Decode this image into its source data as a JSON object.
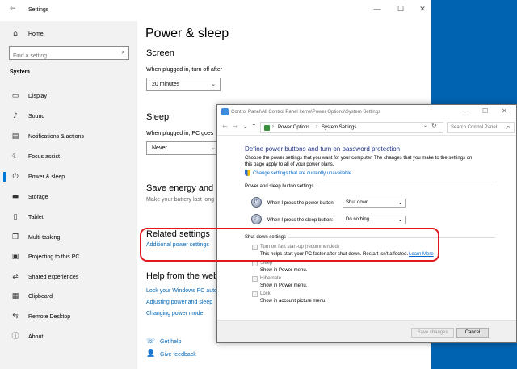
{
  "settings": {
    "title": "Settings",
    "home_label": "Home",
    "search_placeholder": "Find a setting",
    "section_label": "System",
    "sidebar_items": [
      {
        "label": "Display",
        "icon": "display-icon"
      },
      {
        "label": "Sound",
        "icon": "sound-icon"
      },
      {
        "label": "Notifications & actions",
        "icon": "notifications-icon"
      },
      {
        "label": "Focus assist",
        "icon": "moon-icon"
      },
      {
        "label": "Power & sleep",
        "icon": "power-icon"
      },
      {
        "label": "Storage",
        "icon": "storage-icon"
      },
      {
        "label": "Tablet",
        "icon": "tablet-icon"
      },
      {
        "label": "Multi-tasking",
        "icon": "multitasking-icon"
      },
      {
        "label": "Projecting to this PC",
        "icon": "projecting-icon"
      },
      {
        "label": "Shared experiences",
        "icon": "shared-icon"
      },
      {
        "label": "Clipboard",
        "icon": "clipboard-icon"
      },
      {
        "label": "Remote Desktop",
        "icon": "remote-icon"
      },
      {
        "label": "About",
        "icon": "info-icon"
      }
    ],
    "page_title": "Power & sleep",
    "screen_heading": "Screen",
    "screen_label": "When plugged in, turn off after",
    "screen_value": "20 minutes",
    "sleep_heading": "Sleep",
    "sleep_label": "When plugged in, PC goes",
    "sleep_value": "Never",
    "save_heading": "Save energy and ba",
    "save_text": "Make your battery last long",
    "related_heading": "Related settings",
    "related_link": "Additional power settings",
    "help_heading": "Help from the web",
    "help_links": [
      "Lock your Windows PC auto",
      "Adjusting power and sleep",
      "Changing power mode"
    ],
    "get_help": "Get help",
    "give_feedback": "Give feedback"
  },
  "cp": {
    "title": "Control Panel\\All Control Panel Items\\Power Options\\System Settings",
    "breadcrumb_1": "Power Options",
    "breadcrumb_2": "System Settings",
    "search_placeholder": "Search Control Panel",
    "heading": "Define power buttons and turn on password protection",
    "intro_line1": "Choose the power settings that you want for your computer. The changes that you make to the settings on",
    "intro_line2": "this page apply to all of your power plans.",
    "change_link": "Change settings that are currently unavailable",
    "power_group": "Power and sleep button settings",
    "power_label": "When I press the power button:",
    "power_value": "Shut down",
    "sleep_label": "When I press the sleep button:",
    "sleep_value": "Do nothing",
    "shutdown_group": "Shut-down settings",
    "fast_startup_label": "Turn on fast start-up (recommended)",
    "fast_startup_desc": "This helps start your PC faster after shut-down. Restart isn't affected.",
    "learn_more": "Learn More",
    "sleep_opt": "Sleep",
    "sleep_desc": "Show in Power menu.",
    "hibernate_opt": "Hibernate",
    "hibernate_desc": "Show in Power menu.",
    "lock_opt": "Lock",
    "lock_desc": "Show in account picture menu.",
    "save_button": "Save changes",
    "cancel_button": "Cancel"
  },
  "colors": {
    "accent": "#0078d7",
    "highlight": "#e0191f",
    "desktop": "#0063b1"
  }
}
